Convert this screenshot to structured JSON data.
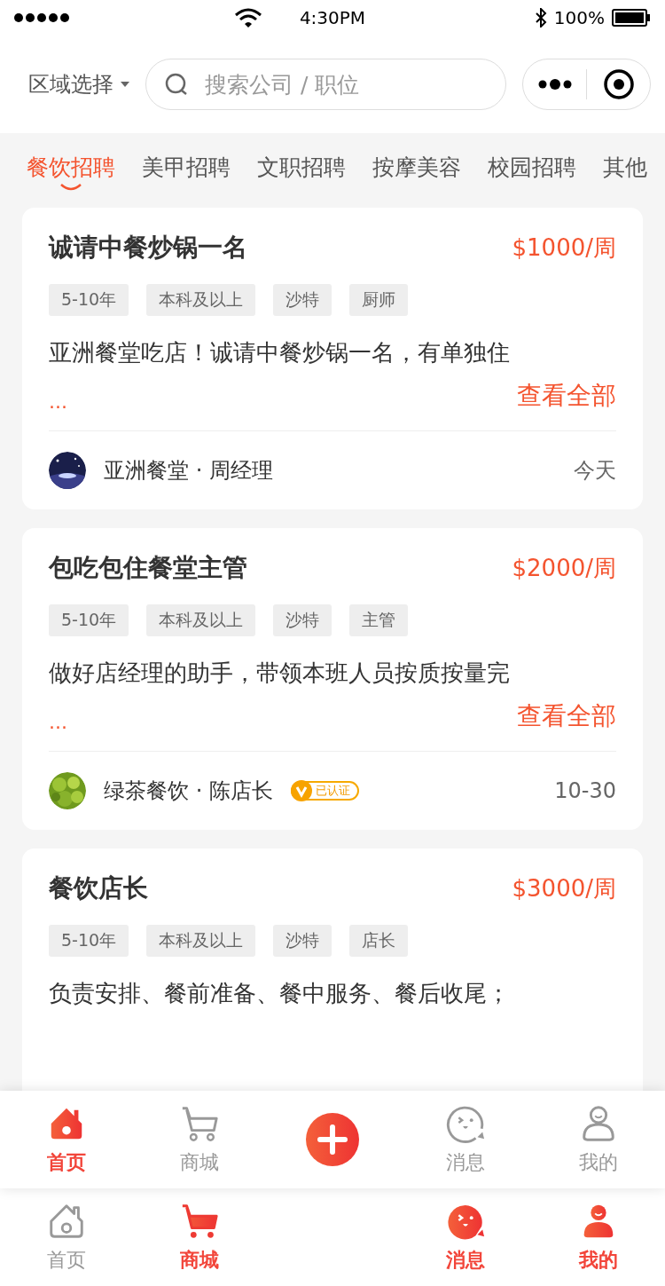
{
  "status_bar": {
    "time": "4:30PM",
    "battery": "100%"
  },
  "header": {
    "region": "区域选择",
    "search": {
      "placeholder": "搜索公司 / 职位"
    }
  },
  "categories": [
    {
      "label": "餐饮招聘",
      "selected": true
    },
    {
      "label": "美甲招聘",
      "selected": false
    },
    {
      "label": "文职招聘",
      "selected": false
    },
    {
      "label": "按摩美容",
      "selected": false
    },
    {
      "label": "校园招聘",
      "selected": false
    },
    {
      "label": "其他",
      "selected": false
    }
  ],
  "jobs": [
    {
      "title": "诚请中餐炒锅一名",
      "salary": "$1000/周",
      "tags": [
        "5-10年",
        "本科及以上",
        "沙特",
        "厨师"
      ],
      "description": "亚洲餐堂吃店！诚请中餐炒锅一名，有单独住",
      "ellipsis": "...",
      "more": "查看全部",
      "company": "亚洲餐堂",
      "separator": "·",
      "contact": "周经理",
      "verified": false,
      "date": "今天"
    },
    {
      "title": "包吃包住餐堂主管",
      "salary": "$2000/周",
      "tags": [
        "5-10年",
        "本科及以上",
        "沙特",
        "主管"
      ],
      "description": "做好店经理的助手，带领本班人员按质按量完",
      "ellipsis": "...",
      "more": "查看全部",
      "company": "绿茶餐饮",
      "separator": "·",
      "contact": "陈店长",
      "verified": true,
      "verified_label": "已认证",
      "date": "10-30"
    },
    {
      "title": "餐饮店长",
      "salary": "$3000/周",
      "tags": [
        "5-10年",
        "本科及以上",
        "沙特",
        "店长"
      ],
      "description": "负责安排、餐前准备、餐中服务、餐后收尾；"
    }
  ],
  "nav_bars": [
    {
      "items": [
        {
          "kind": "tab",
          "label": "首页",
          "selected": true
        },
        {
          "kind": "tab",
          "label": "商城",
          "selected": false
        },
        {
          "kind": "add"
        },
        {
          "kind": "tab",
          "label": "消息",
          "selected": false
        },
        {
          "kind": "tab",
          "label": "我的",
          "selected": false
        }
      ]
    },
    {
      "items": [
        {
          "kind": "tab",
          "label": "首页",
          "selected": false
        },
        {
          "kind": "tab",
          "label": "商城",
          "selected": true
        },
        {
          "kind": "gap"
        },
        {
          "kind": "tab",
          "label": "消息",
          "selected": true
        },
        {
          "kind": "tab",
          "label": "我的",
          "selected": true
        }
      ]
    }
  ]
}
